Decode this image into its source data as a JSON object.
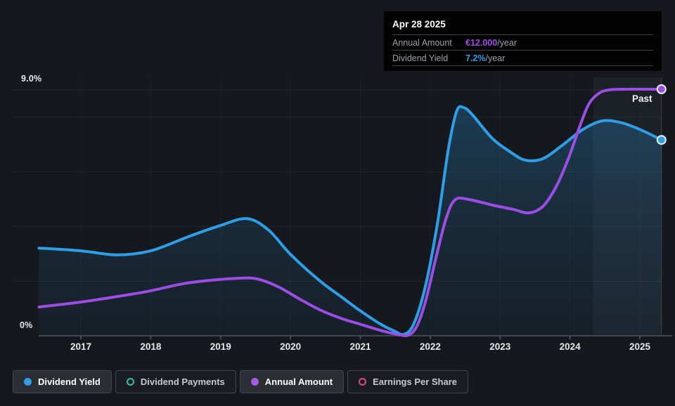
{
  "tooltip": {
    "date": "Apr 28 2025",
    "rows": [
      {
        "label": "Annual Amount",
        "value": "€12.000",
        "suffix": "/year",
        "value_color": "#a44ee8"
      },
      {
        "label": "Dividend Yield",
        "value": "7.2%",
        "suffix": "/year",
        "value_color": "#2f9fe8"
      }
    ]
  },
  "annotations": {
    "past_label": "Past"
  },
  "y_axis": {
    "top_label": "9.0%",
    "bottom_label": "0%"
  },
  "x_axis": {
    "ticks": [
      "2017",
      "2018",
      "2019",
      "2020",
      "2021",
      "2022",
      "2023",
      "2024",
      "2025"
    ]
  },
  "legend": [
    {
      "label": "Dividend Yield",
      "state": "active",
      "marker": "filled",
      "color": "#2e9ee6"
    },
    {
      "label": "Dividend Payments",
      "state": "inactive",
      "marker": "ring",
      "color": "#2fbfa4"
    },
    {
      "label": "Annual Amount",
      "state": "active",
      "marker": "filled",
      "color": "#a55ce4"
    },
    {
      "label": "Earnings Per Share",
      "state": "inactive",
      "marker": "ring",
      "color": "#dd4880"
    }
  ],
  "chart_data": {
    "type": "area",
    "title": "Dividend history",
    "x_tick_years": [
      2017,
      2018,
      2019,
      2020,
      2021,
      2022,
      2023,
      2024,
      2025
    ],
    "gridlines_pct": [
      9,
      8,
      6,
      4,
      2
    ],
    "grid": true,
    "legend_position": "bottom",
    "highlight_band": {
      "from": 2024.33,
      "to": 2025.31
    },
    "today_marker": 2025.31,
    "scales": {
      "x": {
        "domain": [
          2017,
          2025
        ],
        "range": [
          115,
          910
        ]
      },
      "yield": {
        "domain": [
          0,
          9
        ],
        "range": [
          478,
          128
        ]
      },
      "amount": {
        "domain": [
          0,
          12
        ],
        "range": [
          478,
          127
        ]
      }
    },
    "series": [
      {
        "name": "Dividend Yield",
        "unit": "%",
        "axis": "yield",
        "color": "#2e9ee6",
        "fill": true,
        "end_label": "7.2%/year",
        "points": [
          [
            2016.4,
            3.21
          ],
          [
            2017.0,
            3.11
          ],
          [
            2017.52,
            2.96
          ],
          [
            2018.0,
            3.11
          ],
          [
            2018.56,
            3.65
          ],
          [
            2019.0,
            4.04
          ],
          [
            2019.38,
            4.29
          ],
          [
            2019.69,
            3.86
          ],
          [
            2020.0,
            2.98
          ],
          [
            2020.42,
            2.01
          ],
          [
            2020.72,
            1.44
          ],
          [
            2020.98,
            0.95
          ],
          [
            2021.28,
            0.44
          ],
          [
            2021.48,
            0.18
          ],
          [
            2021.62,
            0.05
          ],
          [
            2021.76,
            0.41
          ],
          [
            2021.93,
            1.8
          ],
          [
            2022.1,
            4.06
          ],
          [
            2022.26,
            6.84
          ],
          [
            2022.38,
            8.23
          ],
          [
            2022.48,
            8.35
          ],
          [
            2022.6,
            8.1
          ],
          [
            2022.89,
            7.22
          ],
          [
            2023.14,
            6.74
          ],
          [
            2023.36,
            6.43
          ],
          [
            2023.61,
            6.48
          ],
          [
            2023.89,
            6.97
          ],
          [
            2024.19,
            7.56
          ],
          [
            2024.47,
            7.87
          ],
          [
            2024.75,
            7.79
          ],
          [
            2025.02,
            7.53
          ],
          [
            2025.31,
            7.17
          ]
        ]
      },
      {
        "name": "Annual Amount",
        "unit": "EUR",
        "axis": "amount",
        "color": "#9b4de4",
        "fill": false,
        "end_label": "€12.000/year",
        "points": [
          [
            2016.4,
            1.4
          ],
          [
            2017.0,
            1.64
          ],
          [
            2017.52,
            1.91
          ],
          [
            2018.0,
            2.19
          ],
          [
            2018.46,
            2.53
          ],
          [
            2018.86,
            2.7
          ],
          [
            2019.26,
            2.8
          ],
          [
            2019.52,
            2.77
          ],
          [
            2019.82,
            2.39
          ],
          [
            2020.12,
            1.81
          ],
          [
            2020.42,
            1.26
          ],
          [
            2020.72,
            0.85
          ],
          [
            2020.98,
            0.58
          ],
          [
            2021.28,
            0.27
          ],
          [
            2021.48,
            0.1
          ],
          [
            2021.66,
            0.0
          ],
          [
            2021.8,
            0.41
          ],
          [
            2021.93,
            1.64
          ],
          [
            2022.08,
            3.76
          ],
          [
            2022.23,
            5.74
          ],
          [
            2022.36,
            6.63
          ],
          [
            2022.56,
            6.63
          ],
          [
            2022.89,
            6.36
          ],
          [
            2023.19,
            6.15
          ],
          [
            2023.41,
            5.98
          ],
          [
            2023.61,
            6.29
          ],
          [
            2023.79,
            7.18
          ],
          [
            2023.97,
            8.55
          ],
          [
            2024.14,
            10.19
          ],
          [
            2024.27,
            11.28
          ],
          [
            2024.41,
            11.79
          ],
          [
            2024.57,
            11.97
          ],
          [
            2024.9,
            12.0
          ],
          [
            2025.31,
            12.0
          ]
        ]
      }
    ]
  }
}
